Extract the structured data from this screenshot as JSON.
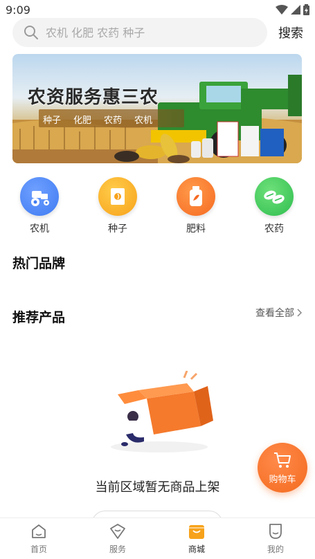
{
  "status_bar": {
    "time": "9:09"
  },
  "search": {
    "placeholder": "农机 化肥 农药 种子",
    "button_label": "搜索"
  },
  "banner": {
    "title": "农资服务惠三农",
    "tags": [
      "种子",
      "化肥",
      "农药",
      "农机"
    ]
  },
  "categories": [
    {
      "label": "农机",
      "icon": "tractor-icon",
      "color": "#3f7bf2"
    },
    {
      "label": "种子",
      "icon": "seed-bag-icon",
      "color": "#f7a21a"
    },
    {
      "label": "肥料",
      "icon": "fertilizer-bottle-icon",
      "color": "#f56a22"
    },
    {
      "label": "农药",
      "icon": "pesticide-leaf-icon",
      "color": "#2fbe4f"
    }
  ],
  "sections": {
    "hot_brands": "热门品牌",
    "recommended": "推荐产品",
    "view_all": "查看全部"
  },
  "empty_state": {
    "message": "当前区域暂无商品上架"
  },
  "cart": {
    "label": "购物车",
    "color": "#f36a1e"
  },
  "tabbar": [
    {
      "label": "首页",
      "icon": "home-icon",
      "active": false
    },
    {
      "label": "服务",
      "icon": "service-icon",
      "active": false
    },
    {
      "label": "商城",
      "icon": "mall-icon",
      "active": true
    },
    {
      "label": "我的",
      "icon": "profile-icon",
      "active": false
    }
  ]
}
